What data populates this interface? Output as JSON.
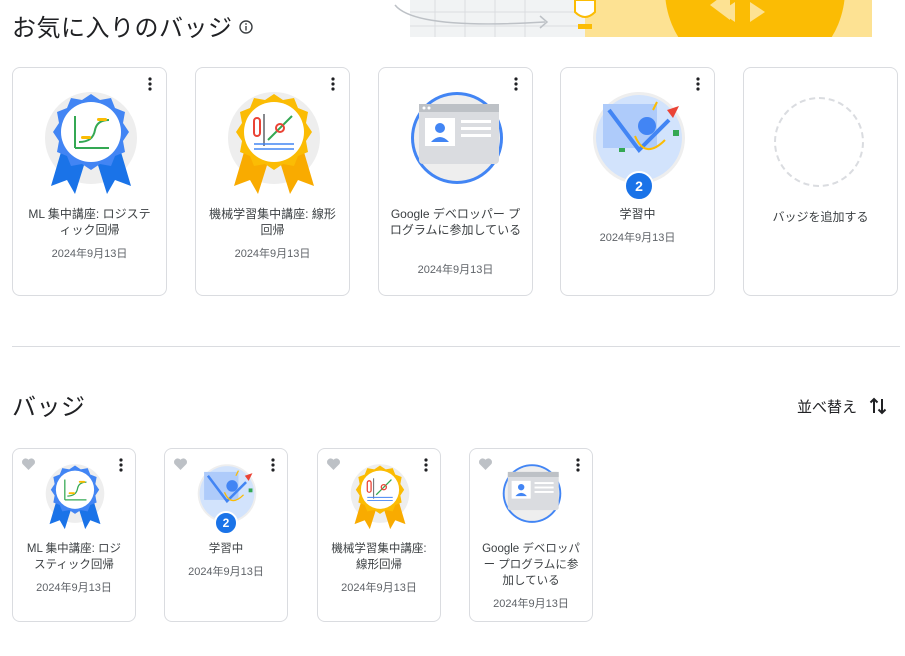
{
  "favorites": {
    "title": "お気に入りのバッジ",
    "info_icon": "info-icon",
    "cards": [
      {
        "name": "ML 集中講座: ロジスティック回帰",
        "date": "2024年9月13日",
        "badge": "ribbon-blue"
      },
      {
        "name": "機械学習集中講座: 線形回帰",
        "date": "2024年9月13日",
        "badge": "ribbon-yellow"
      },
      {
        "name": "Google デベロッパー プログラムに参加している",
        "date": "2024年9月13日",
        "badge": "profile"
      },
      {
        "name": "学習中",
        "date": "2024年9月13日",
        "badge": "learning",
        "count": "2"
      }
    ],
    "add_label": "バッジを追加する"
  },
  "badges": {
    "title": "バッジ",
    "sort_label": "並べ替え",
    "sort_icon": "sort-arrows-icon",
    "cards": [
      {
        "name": "ML 集中講座: ロジスティック回帰",
        "date": "2024年9月13日",
        "badge": "ribbon-blue"
      },
      {
        "name": "学習中",
        "date": "2024年9月13日",
        "badge": "learning",
        "count": "2"
      },
      {
        "name": "機械学習集中講座: 線形回帰",
        "date": "2024年9月13日",
        "badge": "ribbon-yellow"
      },
      {
        "name": "Google デベロッパー プログラムに参加している",
        "date": "2024年9月13日",
        "badge": "profile"
      }
    ]
  },
  "colors": {
    "blue": "#1a73e8",
    "yellow": "#fbbc04",
    "border": "#dadce0",
    "heart": "#bdc1c6"
  }
}
